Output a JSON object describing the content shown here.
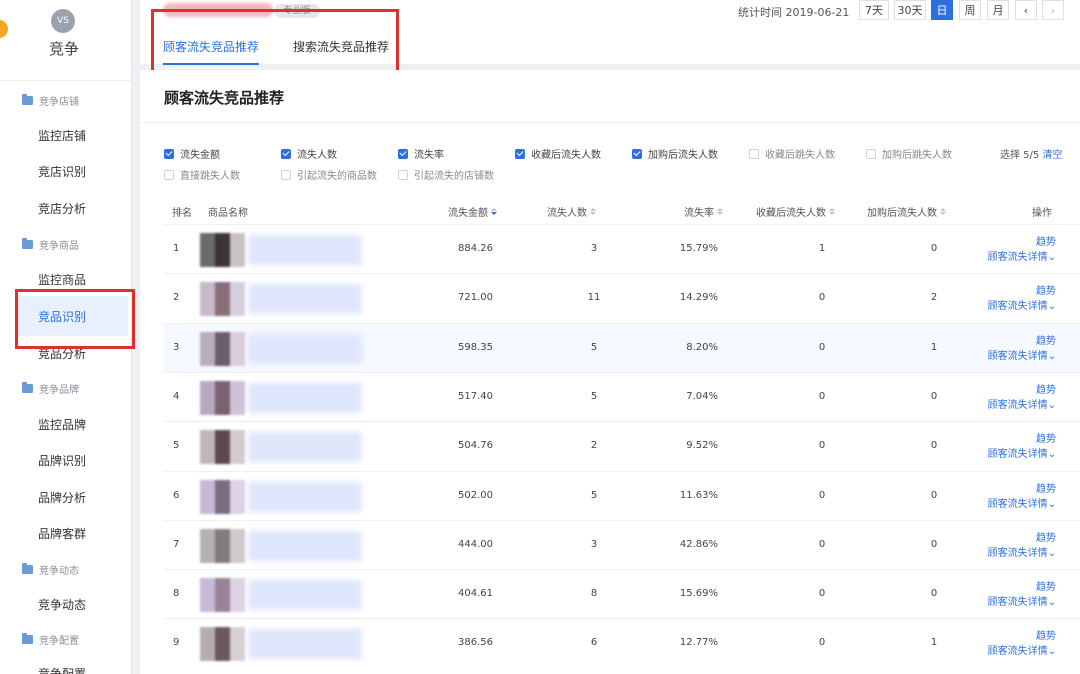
{
  "sidebar": {
    "logo": "VS",
    "title": "竞争",
    "groups": [
      {
        "label": "竞争店铺"
      },
      {
        "label": "竞争商品"
      },
      {
        "label": "竞争品牌"
      },
      {
        "label": "竞争动态"
      },
      {
        "label": "竞争配置"
      }
    ],
    "items": [
      {
        "label": "监控店铺"
      },
      {
        "label": "竞店识别"
      },
      {
        "label": "竞店分析"
      },
      {
        "label": "监控商品"
      },
      {
        "label": "竞品识别"
      },
      {
        "label": "竞品分析"
      },
      {
        "label": "监控品牌"
      },
      {
        "label": "品牌识别"
      },
      {
        "label": "品牌分析"
      },
      {
        "label": "品牌客群"
      },
      {
        "label": "竞争动态"
      },
      {
        "label": "竞争配置"
      }
    ]
  },
  "header": {
    "badge": "专业版",
    "stat_time": "统计时间 2019-06-21",
    "periods": [
      "7天",
      "30天",
      "日",
      "周",
      "月"
    ],
    "active_period": "日",
    "tabs": [
      {
        "label": "顾客流失竞品推荐"
      },
      {
        "label": "搜索流失竞品推荐"
      }
    ]
  },
  "card": {
    "title": "顾客流失竞品推荐",
    "checkboxes": [
      {
        "label": "流失金额",
        "checked": true
      },
      {
        "label": "流失人数",
        "checked": true
      },
      {
        "label": "流失率",
        "checked": true
      },
      {
        "label": "收藏后流失人数",
        "checked": true
      },
      {
        "label": "加购后流失人数",
        "checked": true
      },
      {
        "label": "收藏后跳失人数",
        "checked": false
      },
      {
        "label": "加购后跳失人数",
        "checked": false
      },
      {
        "label": "直接跳失人数",
        "checked": false
      },
      {
        "label": "引起流失的商品数",
        "checked": false
      },
      {
        "label": "引起流失的店铺数",
        "checked": false
      }
    ],
    "select_count": "选择 5/5",
    "clear_label": "清空"
  },
  "table": {
    "headers": {
      "rank": "排名",
      "name": "商品名称",
      "amount": "流失金额",
      "users": "流失人数",
      "rate": "流失率",
      "fav": "收藏后流失人数",
      "cart": "加购后流失人数",
      "ops": "操作"
    },
    "op_trend": "趋势",
    "op_detail": "顾客流失详情",
    "rows": [
      {
        "rank": "1",
        "amount": "884.26",
        "users": "3",
        "rate": "15.79%",
        "fav": "1",
        "cart": "0"
      },
      {
        "rank": "2",
        "amount": "721.00",
        "users": "11",
        "rate": "14.29%",
        "fav": "0",
        "cart": "2"
      },
      {
        "rank": "3",
        "amount": "598.35",
        "users": "5",
        "rate": "8.20%",
        "fav": "0",
        "cart": "1"
      },
      {
        "rank": "4",
        "amount": "517.40",
        "users": "5",
        "rate": "7.04%",
        "fav": "0",
        "cart": "0"
      },
      {
        "rank": "5",
        "amount": "504.76",
        "users": "2",
        "rate": "9.52%",
        "fav": "0",
        "cart": "0"
      },
      {
        "rank": "6",
        "amount": "502.00",
        "users": "5",
        "rate": "11.63%",
        "fav": "0",
        "cart": "0"
      },
      {
        "rank": "7",
        "amount": "444.00",
        "users": "3",
        "rate": "42.86%",
        "fav": "0",
        "cart": "0"
      },
      {
        "rank": "8",
        "amount": "404.61",
        "users": "8",
        "rate": "15.69%",
        "fav": "0",
        "cart": "0"
      },
      {
        "rank": "9",
        "amount": "386.56",
        "users": "6",
        "rate": "12.77%",
        "fav": "0",
        "cart": "1"
      }
    ]
  },
  "colors": {
    "accent": "#2e6fe0",
    "highlight_box": "#e0302b"
  }
}
